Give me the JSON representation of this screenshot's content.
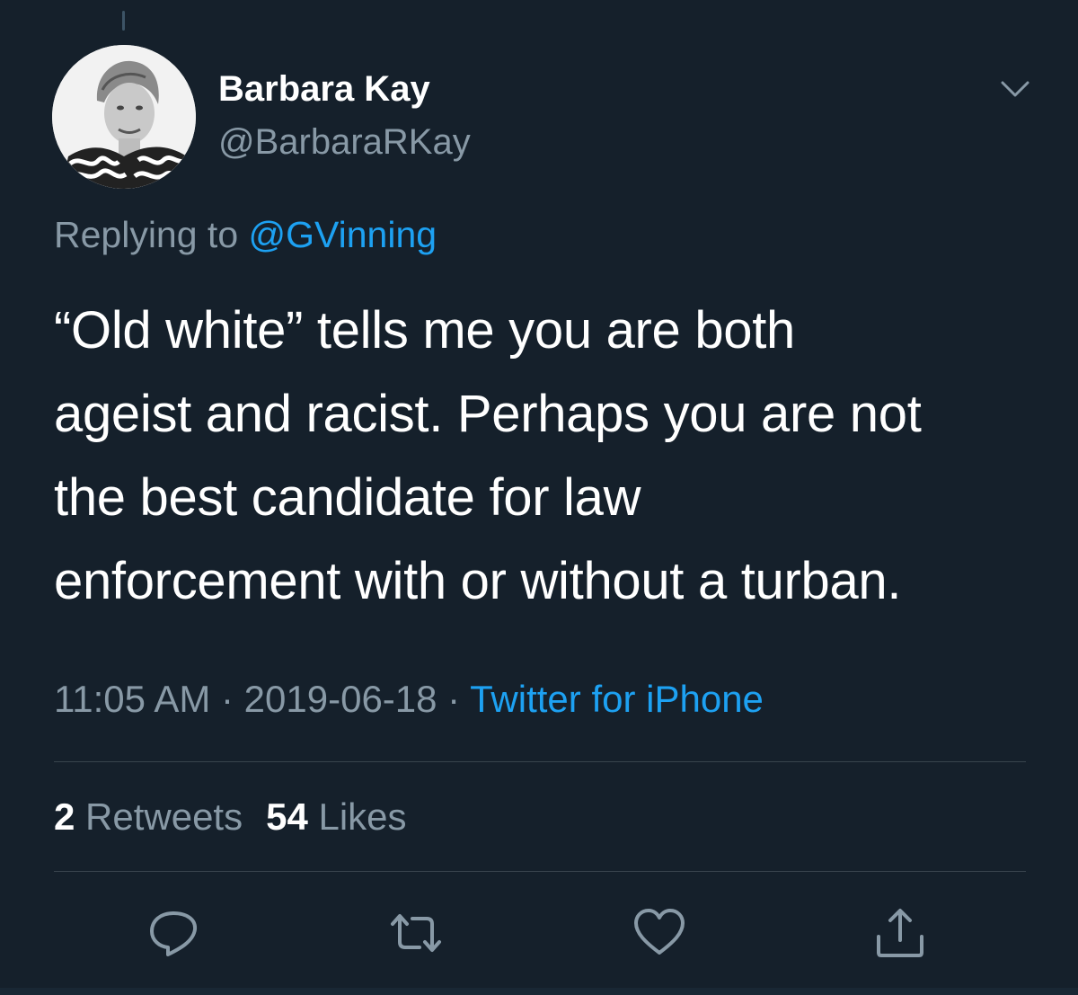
{
  "tweet": {
    "author": {
      "display_name": "Barbara Kay",
      "handle": "@BarbaraRKay",
      "avatar_icon": "profile-photo"
    },
    "replying_prefix": "Replying to ",
    "replying_to": "@GVinning",
    "text_lines": [
      "“Old white” tells me you are both",
      "ageist and racist. Perhaps you are not",
      "the best candidate for law",
      "enforcement with or without a turban."
    ],
    "time": "11:05 AM",
    "separator": " · ",
    "date": "2019-06-18",
    "source": "Twitter for iPhone",
    "retweets_count": "2",
    "retweets_label": " Retweets",
    "likes_count": "54",
    "likes_label": " Likes"
  },
  "actions": [
    {
      "name": "reply",
      "icon": "reply-icon"
    },
    {
      "name": "retweet",
      "icon": "retweet-icon"
    },
    {
      "name": "like",
      "icon": "heart-icon"
    },
    {
      "name": "share",
      "icon": "share-icon"
    }
  ],
  "colors": {
    "background": "#15202b",
    "primary_text": "#ffffff",
    "secondary_text": "#8899a6",
    "accent": "#1da1f2",
    "divider": "#38444d"
  }
}
